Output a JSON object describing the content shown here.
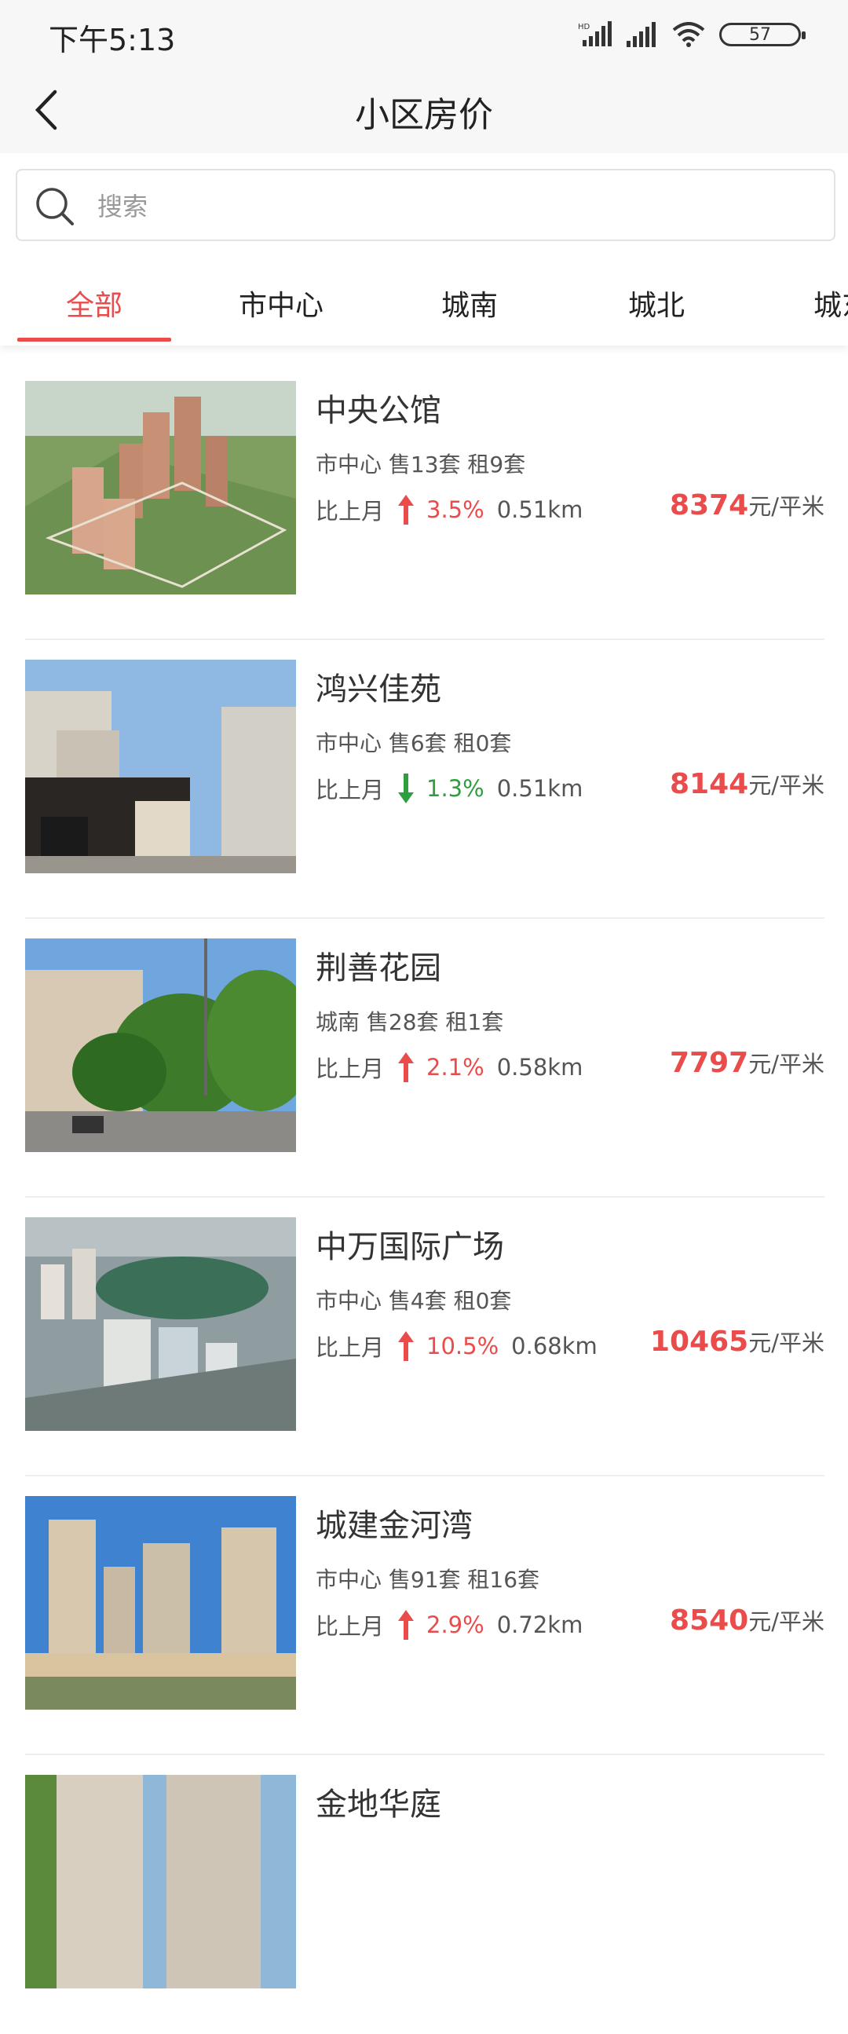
{
  "status_bar": {
    "time": "下午5:13",
    "battery": "57"
  },
  "nav": {
    "title": "小区房价"
  },
  "search": {
    "placeholder": "搜索"
  },
  "tabs": [
    {
      "label": "全部",
      "active": true
    },
    {
      "label": "市中心"
    },
    {
      "label": "城南"
    },
    {
      "label": "城北"
    },
    {
      "label": "城东"
    }
  ],
  "colors": {
    "accent_red": "#ea4b4b",
    "down_green": "#2e9e3e"
  },
  "listings": [
    {
      "name": "中央公馆",
      "meta": "市中心 售13套 租9套",
      "trend_label": "比上月",
      "direction": "up",
      "change": "3.5%",
      "distance": "0.51km",
      "price": "8374",
      "unit": "元/平米"
    },
    {
      "name": "鸿兴佳苑",
      "meta": "市中心 售6套 租0套",
      "trend_label": "比上月",
      "direction": "down",
      "change": "1.3%",
      "distance": "0.51km",
      "price": "8144",
      "unit": "元/平米"
    },
    {
      "name": "荆善花园",
      "meta": "城南 售28套 租1套",
      "trend_label": "比上月",
      "direction": "up",
      "change": "2.1%",
      "distance": "0.58km",
      "price": "7797",
      "unit": "元/平米"
    },
    {
      "name": "中万国际广场",
      "meta": "市中心 售4套 租0套",
      "trend_label": "比上月",
      "direction": "up",
      "change": "10.5%",
      "distance": "0.68km",
      "price": "10465",
      "unit": "元/平米"
    },
    {
      "name": "城建金河湾",
      "meta": "市中心 售91套 租16套",
      "trend_label": "比上月",
      "direction": "up",
      "change": "2.9%",
      "distance": "0.72km",
      "price": "8540",
      "unit": "元/平米"
    },
    {
      "name": "金地华庭"
    }
  ]
}
